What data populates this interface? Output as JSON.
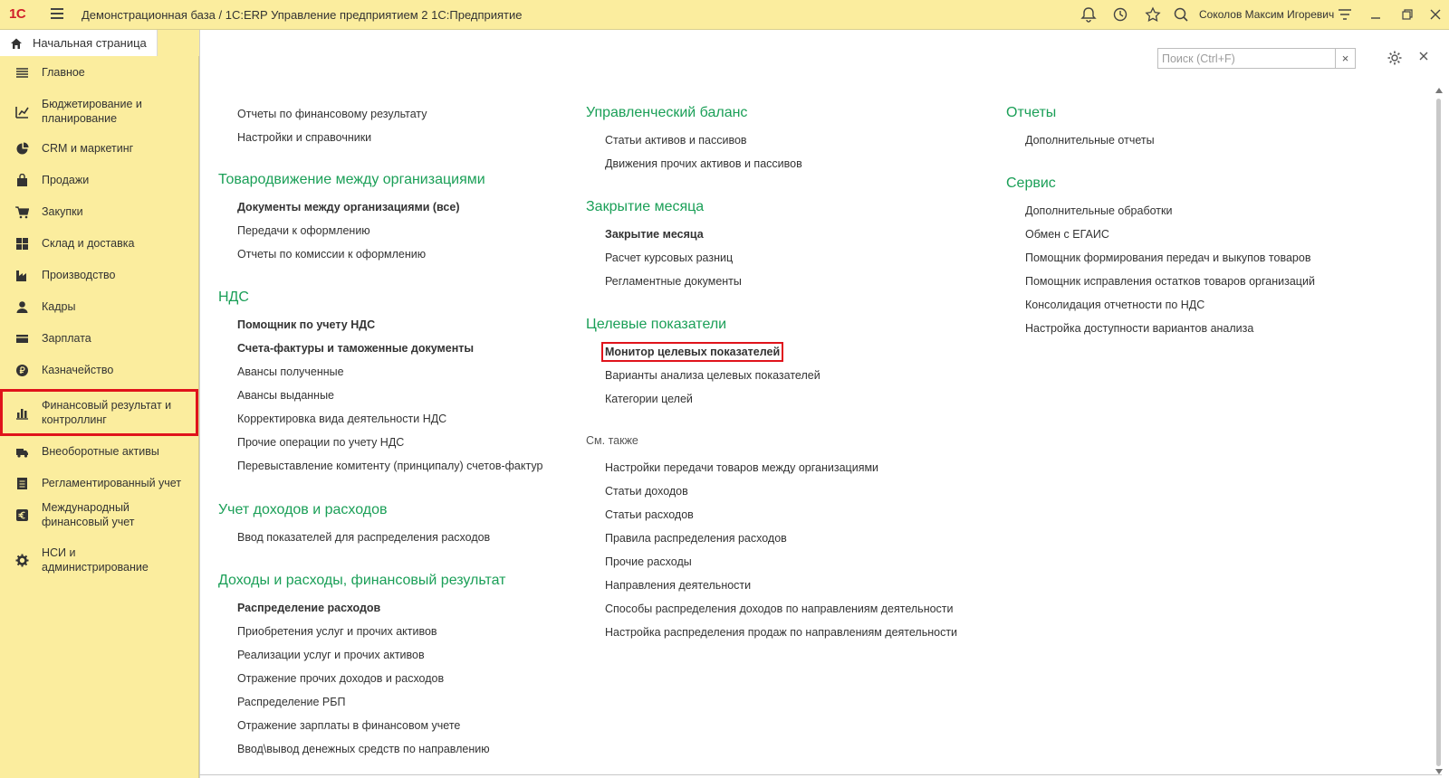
{
  "titlebar": {
    "logo": "1С",
    "title": "Демонстрационная база / 1С:ERP Управление предприятием 2 1С:Предприятие",
    "user": "Соколов Максим Игоревич",
    "icons": [
      "bell-icon",
      "history-icon",
      "star-icon",
      "search-icon",
      "settings-menu-icon",
      "minimize-icon",
      "restore-icon",
      "close-icon"
    ]
  },
  "tabs": {
    "home": "Начальная страница"
  },
  "sidebar": {
    "items": [
      {
        "label": "Главное",
        "icon": "list-icon"
      },
      {
        "label": "Бюджетирование и планирование",
        "icon": "budget-icon"
      },
      {
        "label": "CRM и маркетинг",
        "icon": "pie-chart-icon"
      },
      {
        "label": "Продажи",
        "icon": "shopping-bag-icon"
      },
      {
        "label": "Закупки",
        "icon": "cart-icon"
      },
      {
        "label": "Склад и доставка",
        "icon": "warehouse-icon"
      },
      {
        "label": "Производство",
        "icon": "factory-icon"
      },
      {
        "label": "Кадры",
        "icon": "person-icon"
      },
      {
        "label": "Зарплата",
        "icon": "wallet-icon"
      },
      {
        "label": "Казначейство",
        "icon": "coin-icon"
      },
      {
        "label": "Финансовый результат и контроллинг",
        "icon": "bar-chart-icon",
        "selected": true
      },
      {
        "label": "Внеоборотные активы",
        "icon": "truck-icon"
      },
      {
        "label": "Регламентированный учет",
        "icon": "document-icon"
      },
      {
        "label": "Международный финансовый учет",
        "icon": "euro-icon"
      },
      {
        "label": "НСИ и администрирование",
        "icon": "gear-icon"
      }
    ]
  },
  "search": {
    "placeholder": "Поиск (Ctrl+F)",
    "value": "",
    "clear": "×"
  },
  "col1": {
    "top_links": [
      "Отчеты по финансовому результату",
      "Настройки и справочники"
    ],
    "sec_transfer": {
      "title": "Товародвижение между организациями",
      "links": [
        "Документы между организациями (все)",
        "Передачи к оформлению",
        "Отчеты по комиссии к оформлению"
      ]
    },
    "sec_vat": {
      "title": "НДС",
      "links": [
        "Помощник по учету НДС",
        "Счета-фактуры и таможенные документы",
        "Авансы полученные",
        "Авансы выданные",
        "Корректировка вида деятельности НДС",
        "Прочие операции по учету НДС",
        "Перевыставление комитенту (принципалу) счетов-фактур"
      ]
    },
    "sec_income": {
      "title": "Учет доходов и расходов",
      "links": [
        "Ввод показателей для распределения расходов"
      ]
    },
    "sec_finres": {
      "title": "Доходы и расходы, финансовый результат",
      "links": [
        "Распределение расходов",
        "Приобретения услуг и прочих активов",
        "Реализации услуг и прочих активов",
        "Отражение прочих доходов и расходов",
        "Распределение РБП",
        "Отражение зарплаты в финансовом учете",
        "Ввод\\вывод денежных средств по направлению"
      ]
    }
  },
  "col2": {
    "sec_balance": {
      "title": "Управленческий баланс",
      "links": [
        "Статьи активов и пассивов",
        "Движения прочих активов и пассивов"
      ]
    },
    "sec_close": {
      "title": "Закрытие месяца",
      "links": [
        "Закрытие месяца",
        "Расчет курсовых разниц",
        "Регламентные документы"
      ]
    },
    "sec_targets": {
      "title": "Целевые показатели",
      "links": [
        "Монитор целевых показателей",
        "Варианты анализа целевых показателей",
        "Категории целей"
      ]
    },
    "see_also": {
      "title": "См. также",
      "links": [
        "Настройки передачи товаров между организациями",
        "Статьи доходов",
        "Статьи расходов",
        "Правила распределения расходов",
        "Прочие расходы",
        "Направления деятельности",
        "Способы распределения доходов по направлениям деятельности",
        "Настройка распределения продаж по направлениям деятельности"
      ]
    }
  },
  "col3": {
    "sec_reports": {
      "title": "Отчеты",
      "links": [
        "Дополнительные отчеты"
      ]
    },
    "sec_service": {
      "title": "Сервис",
      "links": [
        "Дополнительные обработки",
        "Обмен с ЕГАИС",
        "Помощник формирования передач и выкупов товаров",
        "Помощник исправления остатков товаров организаций",
        "Консолидация отчетности по НДС",
        "Настройка доступности вариантов анализа"
      ]
    }
  },
  "colors": {
    "accent_green": "#1a9f57",
    "highlight_red": "#e0131b",
    "sidebar_bg": "#fbed9e"
  }
}
